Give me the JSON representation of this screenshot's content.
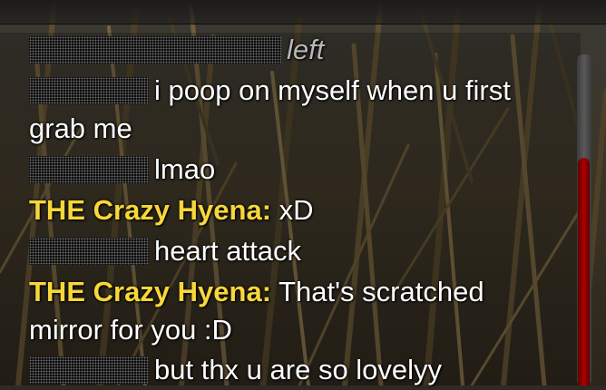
{
  "chat": {
    "messages": [
      {
        "name": "",
        "text": "left",
        "type": "system"
      },
      {
        "name": "",
        "text": "i poop on myself when u first",
        "type": "user"
      },
      {
        "name": "",
        "text": "grab me",
        "type": "continuation"
      },
      {
        "name": "",
        "text": "lmao",
        "type": "user"
      },
      {
        "name": "THE Crazy Hyena:",
        "text": "xD",
        "type": "named"
      },
      {
        "name": "",
        "text": "heart attack",
        "type": "user"
      },
      {
        "name": "THE Crazy Hyena:",
        "text": "That's scratched",
        "type": "named"
      },
      {
        "name": "",
        "text": "mirror for you :D",
        "type": "continuation"
      },
      {
        "name": "",
        "text": "but thx u are so lovelyy",
        "type": "user"
      }
    ]
  },
  "colors": {
    "name_color": "#f7d73a",
    "text_color": "#ffffff",
    "system_color": "#b7b7b7",
    "scrollbar_thumb": "#b00000"
  }
}
